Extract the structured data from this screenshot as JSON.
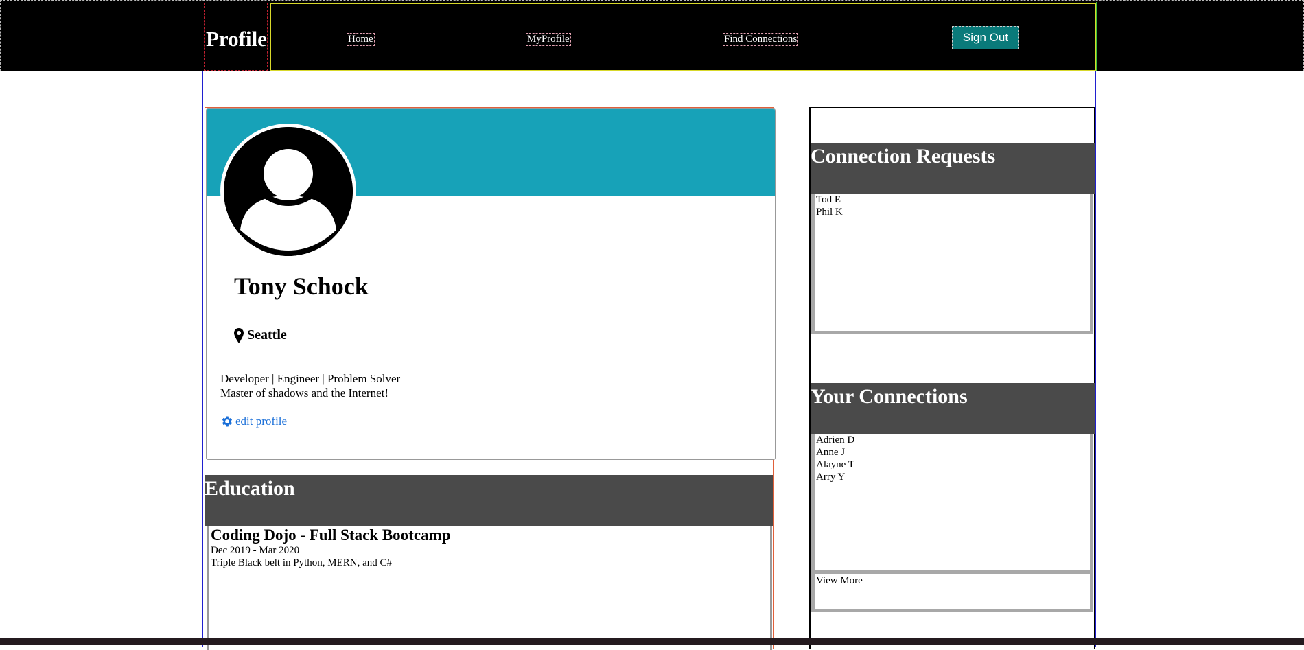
{
  "navbar": {
    "brand": "Profile",
    "links": [
      {
        "label": "Home"
      },
      {
        "label": "MyProfile"
      },
      {
        "label": "Find Connections"
      }
    ],
    "signout_label": "Sign Out"
  },
  "profile": {
    "name": "Tony Schock",
    "location": "Seattle",
    "bio_line1": "Developer | Engineer | Problem Solver",
    "bio_line2": "Master of shadows and the Internet!",
    "edit_label": " edit profile",
    "icons": {
      "avatar": "user-avatar-icon",
      "location": "map-pin-icon",
      "edit": "gear-icon"
    },
    "colors": {
      "banner": "#17a2b8",
      "link": "#1a6fd8"
    }
  },
  "education": {
    "title": "Education",
    "entries": [
      {
        "school": "Coding Dojo - Full Stack Bootcamp",
        "dates": "Dec 2019 - Mar 2020",
        "description": "Triple Black belt in Python, MERN, and C#"
      }
    ]
  },
  "connection_requests": {
    "title": "Connection Requests",
    "items": [
      "Tod E",
      "Phil K"
    ]
  },
  "your_connections": {
    "title": "Your Connections",
    "items": [
      "Adrien D",
      "Anne J",
      "Alayne T",
      "Arry Y"
    ],
    "view_more_label": "View More"
  },
  "colors": {
    "navbar_bg": "#000000",
    "signout_bg": "#0a7a7a",
    "section_header_bg": "#4a4a4a"
  }
}
